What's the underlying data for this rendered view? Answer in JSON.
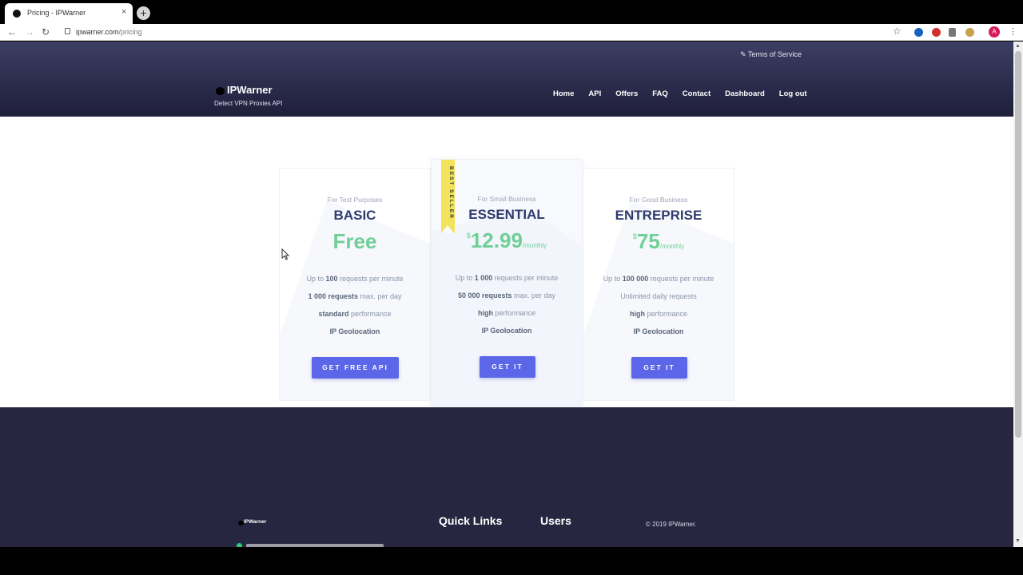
{
  "browser": {
    "tab_title": "Pricing - IPWarner",
    "tab_close": "×",
    "new_tab": "+",
    "url_host": "ipwarner.com",
    "url_path": "/pricing",
    "avatar_letter": "A"
  },
  "header": {
    "terms_label": "Terms of Service",
    "brand": "IPWarner",
    "tagline": "Detect VPN Proxies API",
    "nav": [
      "Home",
      "API",
      "Offers",
      "FAQ",
      "Contact",
      "Dashboard",
      "Log out"
    ]
  },
  "plans": [
    {
      "purpose": "For Test Purposes",
      "name": "BASIC",
      "price_currency": "",
      "price": "Free",
      "price_period": "",
      "features": [
        {
          "pre": "Up to ",
          "bold": "100",
          "post": " requests per minute"
        },
        {
          "pre": "",
          "bold": "1 000 requests",
          "post": " max. per day"
        },
        {
          "pre": "",
          "bold": "standard",
          "post": " performance"
        },
        {
          "pre": "",
          "bold": "IP Geolocation",
          "post": ""
        }
      ],
      "button": "GET FREE API"
    },
    {
      "purpose": "For Small Business",
      "name": "ESSENTIAL",
      "price_currency": "$",
      "price": "12.99",
      "price_period": "/monthly",
      "features": [
        {
          "pre": "Up to ",
          "bold": "1 000",
          "post": " requests per minute"
        },
        {
          "pre": "",
          "bold": "50 000 requests",
          "post": " max. per day"
        },
        {
          "pre": "",
          "bold": "high",
          "post": " performance"
        },
        {
          "pre": "",
          "bold": "IP Geolocation",
          "post": ""
        }
      ],
      "button": "GET IT",
      "ribbon": "BEST SELLER"
    },
    {
      "purpose": "For Good Business",
      "name": "ENTREPRISE",
      "price_currency": "$",
      "price": "75",
      "price_period": "/monthly",
      "features": [
        {
          "pre": "Up to ",
          "bold": "100 000",
          "post": " requests per minute"
        },
        {
          "pre": "Unlimited daily requests",
          "bold": "",
          "post": ""
        },
        {
          "pre": "",
          "bold": "high",
          "post": " performance"
        },
        {
          "pre": "",
          "bold": "IP Geolocation",
          "post": ""
        }
      ],
      "button": "GET IT"
    }
  ],
  "footer": {
    "logo": "IPWarner",
    "quick_links": "Quick Links",
    "users": "Users",
    "copyright": "© 2019 IPWarner."
  },
  "colors": {
    "accent": "#5b66e8",
    "price_green": "#6fcf97",
    "plan_title": "#2f3b6e",
    "header_dark": "#1f1f3a",
    "footer_bg": "#262641",
    "ribbon": "#f2e35a"
  }
}
